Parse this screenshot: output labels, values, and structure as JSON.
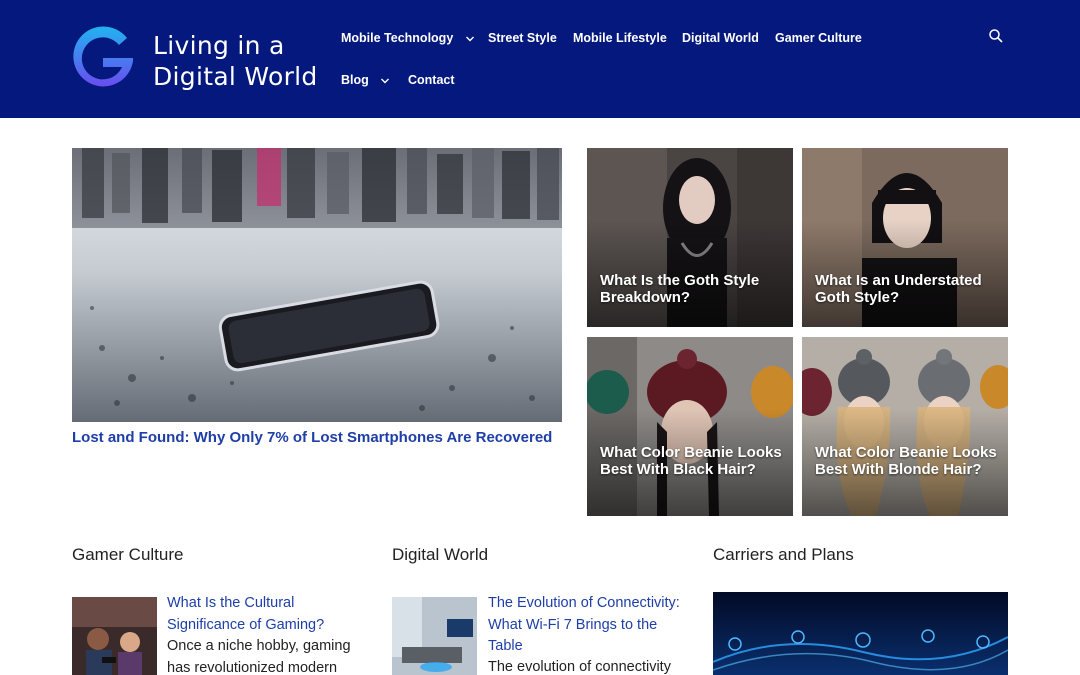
{
  "header": {
    "title_line1": "Living in a",
    "title_line2": "Digital World",
    "bg_color": "#04187e",
    "nav": [
      {
        "label": "Mobile Technology",
        "has_dropdown": true
      },
      {
        "label": "Street Style",
        "has_dropdown": false
      },
      {
        "label": "Mobile Lifestyle",
        "has_dropdown": false
      },
      {
        "label": "Digital World",
        "has_dropdown": false
      },
      {
        "label": "Gamer Culture",
        "has_dropdown": false
      },
      {
        "label": "Blog",
        "has_dropdown": true
      },
      {
        "label": "Contact",
        "has_dropdown": false
      }
    ],
    "search_icon": "search-icon"
  },
  "hero": {
    "main_post": {
      "title": "Lost and Found: Why Only 7% of Lost Smartphones Are Recovered"
    },
    "tiles": [
      {
        "title": "What Is the Goth Style Breakdown?"
      },
      {
        "title": "What Is an Understated Goth Style?"
      },
      {
        "title": "What Color Beanie Looks Best With Black Hair?"
      },
      {
        "title": "What Color Beanie Looks Best With Blonde Hair?"
      }
    ]
  },
  "sections": [
    {
      "heading": "Gamer Culture",
      "post": {
        "title": "What Is the Cultural Significance of Gaming?",
        "excerpt": "Once a niche hobby, gaming has revolutionized modern"
      }
    },
    {
      "heading": "Digital World",
      "post": {
        "title": "The Evolution of Connectivity: What Wi-Fi 7 Brings to the Table",
        "excerpt": "The evolution of connectivity"
      }
    },
    {
      "heading": "Carriers and Plans"
    }
  ],
  "colors": {
    "link": "#1e3ea8",
    "header_bg": "#04187e"
  }
}
